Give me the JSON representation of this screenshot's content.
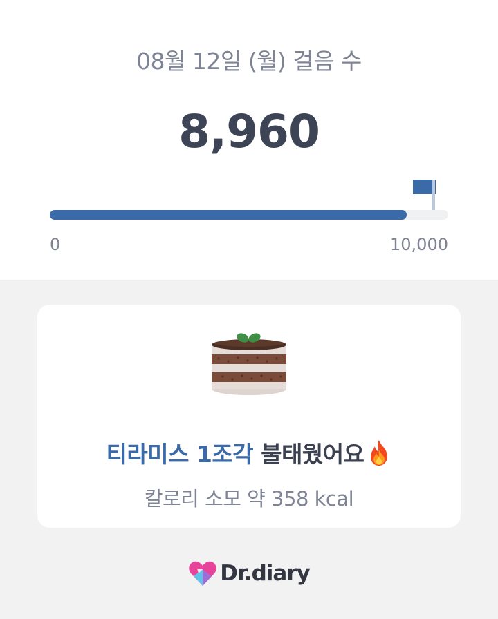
{
  "steps": {
    "date_title": "08월 12일 (월) 걸음 수",
    "count": "8,960",
    "count_value": 8960,
    "goal_value": 10000,
    "axis_min": "0",
    "axis_max": "10,000"
  },
  "burn_card": {
    "food_highlight": "티라미스 1조각",
    "burn_suffix": " 불태웠어요",
    "calorie_text": "칼로리 소모 약 358 kcal",
    "icon": "cake-icon",
    "emoji_icon": "fire-icon"
  },
  "brand": {
    "name": "Dr.diary",
    "logo_icon": "heart-logo-icon"
  },
  "colors": {
    "accent": "#3a6aa8",
    "text_dark": "#3d4455",
    "text_muted": "#7e8494",
    "background": "#f2f2f2"
  }
}
